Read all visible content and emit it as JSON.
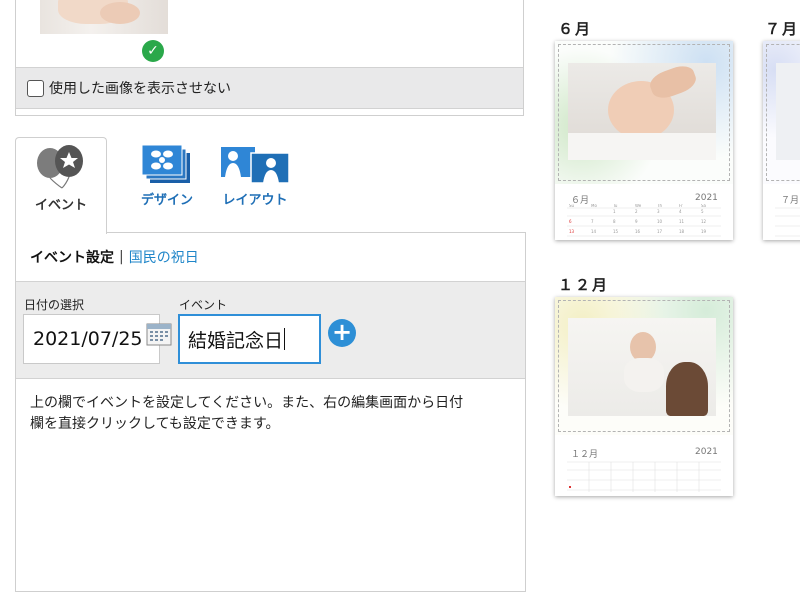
{
  "image_panel": {
    "hide_used_label": "使用した画像を表示させない"
  },
  "tabs": [
    {
      "label": "イベント",
      "icon": "balloon-icon",
      "active": true
    },
    {
      "label": "デザイン",
      "icon": "design-icon",
      "active": false
    },
    {
      "label": "レイアウト",
      "icon": "layout-icon",
      "active": false
    }
  ],
  "event_panel": {
    "header_active": "イベント設定",
    "header_separator": "|",
    "header_link": "国民の祝日",
    "date_label": "日付の選択",
    "date_value": "2021/07/25",
    "event_label": "イベント",
    "event_value": "結婚記念日",
    "help_text_line1": "上の欄でイベントを設定してください。また、右の編集画面から日付",
    "help_text_line2": "欄を直接クリックしても設定できます。"
  },
  "calendar_preview": {
    "months": [
      {
        "heading": "６月",
        "mini_month": "６月",
        "year": "2021"
      },
      {
        "heading": "７月",
        "mini_month": "７月",
        "year": ""
      },
      {
        "heading": "１２月",
        "mini_month": "１２月",
        "year": "2021"
      }
    ]
  },
  "colors": {
    "accent_blue": "#1f86c9",
    "check_green": "#2aa84a",
    "focus_border": "#2f8fd8"
  }
}
